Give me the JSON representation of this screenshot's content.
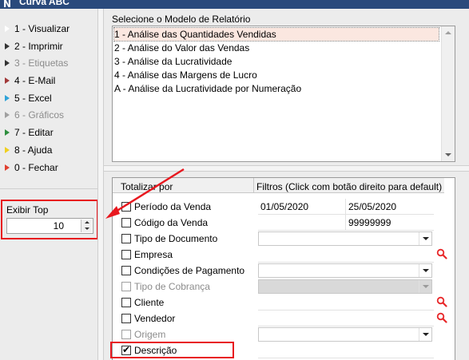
{
  "window": {
    "title": "Curva ABC",
    "logo_glyph": "N"
  },
  "sidebar": {
    "items": [
      {
        "label": "1 - Visualizar",
        "icon": "play-arrow-icon",
        "color": "#ffffff",
        "enabled": true
      },
      {
        "label": "2 - Imprimir",
        "icon": "play-arrow-icon",
        "color": "#333333",
        "enabled": true
      },
      {
        "label": "3 - Etiquetas",
        "icon": "play-arrow-icon",
        "color": "#333333",
        "enabled": false
      },
      {
        "label": "4 - E-Mail",
        "icon": "play-arrow-icon",
        "color": "#a23a3a",
        "enabled": true
      },
      {
        "label": "5 - Excel",
        "icon": "play-arrow-icon",
        "color": "#2fa3d8",
        "enabled": true
      },
      {
        "label": "6 - Gráficos",
        "icon": "play-arrow-icon",
        "color": "#a0a0a0",
        "enabled": false
      },
      {
        "label": "7 - Editar",
        "icon": "play-arrow-icon",
        "color": "#2f8f3f",
        "enabled": true
      },
      {
        "label": "8 - Ajuda",
        "icon": "play-arrow-icon",
        "color": "#f0d020",
        "enabled": true
      },
      {
        "label": "0 - Fechar",
        "icon": "play-arrow-icon",
        "color": "#e04030",
        "enabled": true
      }
    ],
    "exibir_top": {
      "label": "Exibir Top",
      "value": "10"
    }
  },
  "model": {
    "label": "Selecione o Modelo de Relatório",
    "items": [
      "1 - Análise das Quantidades Vendidas",
      "2 - Análise do Valor das Vendas",
      "3 - Análise da Lucratividade",
      "4 - Análise das Margens de Lucro",
      "A - Análise da Lucratividade por Numeração"
    ],
    "selected_index": 0
  },
  "grid": {
    "header_totalizar": "Totalizar por",
    "header_filtros": "Filtros (Click com botão direito para default)",
    "rows": [
      {
        "label": "Período da Venda",
        "checked": false,
        "enabled": true,
        "value1": "01/05/2020",
        "value2": "25/05/2020"
      },
      {
        "label": "Código da Venda",
        "checked": false,
        "enabled": true,
        "value1": "",
        "value2": "99999999"
      },
      {
        "label": "Tipo de Documento",
        "checked": false,
        "enabled": true
      },
      {
        "label": "Empresa",
        "checked": false,
        "enabled": true
      },
      {
        "label": "Condições de Pagamento",
        "checked": false,
        "enabled": true
      },
      {
        "label": "Tipo de Cobrança",
        "checked": false,
        "enabled": false
      },
      {
        "label": "Cliente",
        "checked": false,
        "enabled": true
      },
      {
        "label": "Vendedor",
        "checked": false,
        "enabled": true
      },
      {
        "label": "Origem",
        "checked": false,
        "enabled": false
      },
      {
        "label": "Descrição",
        "checked": true,
        "enabled": true
      }
    ]
  },
  "annotation": {
    "highlight_color": "#e8181f"
  }
}
